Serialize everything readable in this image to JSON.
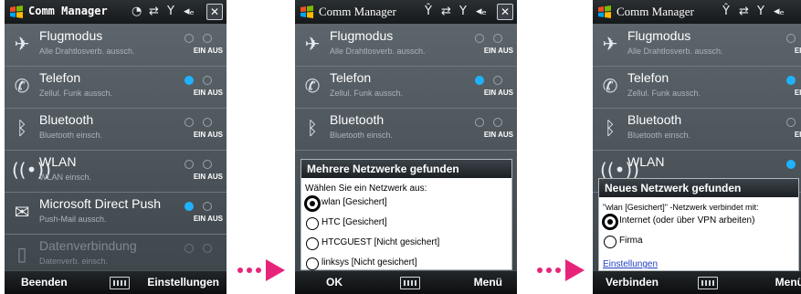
{
  "colors": {
    "accent": "#1fb2ff",
    "arrow": "#e8247a",
    "link": "#1f3fbf"
  },
  "dot_labels": {
    "ein": "EIN",
    "aus": "AUS"
  },
  "icons": {
    "logo": "windows-flag-icon",
    "globe": "globe-icon",
    "sync": "sync-arrows-icon",
    "signal": "signal-antenna-icon",
    "volume": "speaker-icon",
    "close": "close-icon"
  },
  "screens": [
    {
      "title": "Comm Manager",
      "tray_globe": "◔",
      "rows": [
        {
          "label": "Flugmodus",
          "sub": "Alle Drahtlosverb. aussch.",
          "state": "aus"
        },
        {
          "label": "Telefon",
          "sub": "Zellul. Funk aussch.",
          "state": "ein"
        },
        {
          "label": "Bluetooth",
          "sub": "Bluetooth einsch.",
          "state": "aus"
        },
        {
          "label": "WLAN",
          "sub": "WLAN einsch.",
          "state": "aus"
        },
        {
          "label": "Microsoft Direct Push",
          "sub": "Push-Mail aussch.",
          "state": "ein"
        },
        {
          "label": "Datenverbindung",
          "sub": "Datenverb. einsch.",
          "state": "disabled"
        }
      ],
      "softkey_left": "Beenden",
      "softkey_right": "Einstellungen"
    },
    {
      "title": "Comm Manager",
      "rows": [
        {
          "label": "Flugmodus",
          "sub": "Alle Drahtlosverb. aussch.",
          "state": "aus"
        },
        {
          "label": "Telefon",
          "sub": "Zellul. Funk aussch.",
          "state": "ein"
        },
        {
          "label": "Bluetooth",
          "sub": "Bluetooth einsch.",
          "state": "aus"
        }
      ],
      "dialog": {
        "title": "Mehrere Netzwerke gefunden",
        "prompt": "Wählen Sie ein Netzwerk aus:",
        "options": [
          {
            "label": "wlan [Gesichert]",
            "selected": true
          },
          {
            "label": "HTC [Gesichert]",
            "selected": false
          },
          {
            "label": "HTCGUEST [Nicht gesichert]",
            "selected": false
          },
          {
            "label": "linksys [Nicht gesichert]",
            "selected": false
          }
        ]
      },
      "softkey_left": "OK",
      "softkey_right": "Menü"
    },
    {
      "title": "Comm Manager",
      "rows": [
        {
          "label": "Flugmodus",
          "sub": "Alle Drahtlosverb. aussch.",
          "state": "aus"
        },
        {
          "label": "Telefon",
          "sub": "Zellul. Funk aussch.",
          "state": "ein"
        },
        {
          "label": "Bluetooth",
          "sub": "Bluetooth einsch.",
          "state": "aus"
        },
        {
          "label": "WLAN",
          "sub": "",
          "state": "ein"
        }
      ],
      "dialog": {
        "title": "Neues Netzwerk gefunden",
        "prompt": "\"wlan [Gesichert]\" -Netzwerk verbindet mit:",
        "options": [
          {
            "label": "Internet (oder über VPN arbeiten)",
            "selected": true
          },
          {
            "label": "Firma",
            "selected": false
          }
        ],
        "link": "Einstellungen"
      },
      "softkey_left": "Verbinden",
      "softkey_right": "Menü"
    }
  ]
}
